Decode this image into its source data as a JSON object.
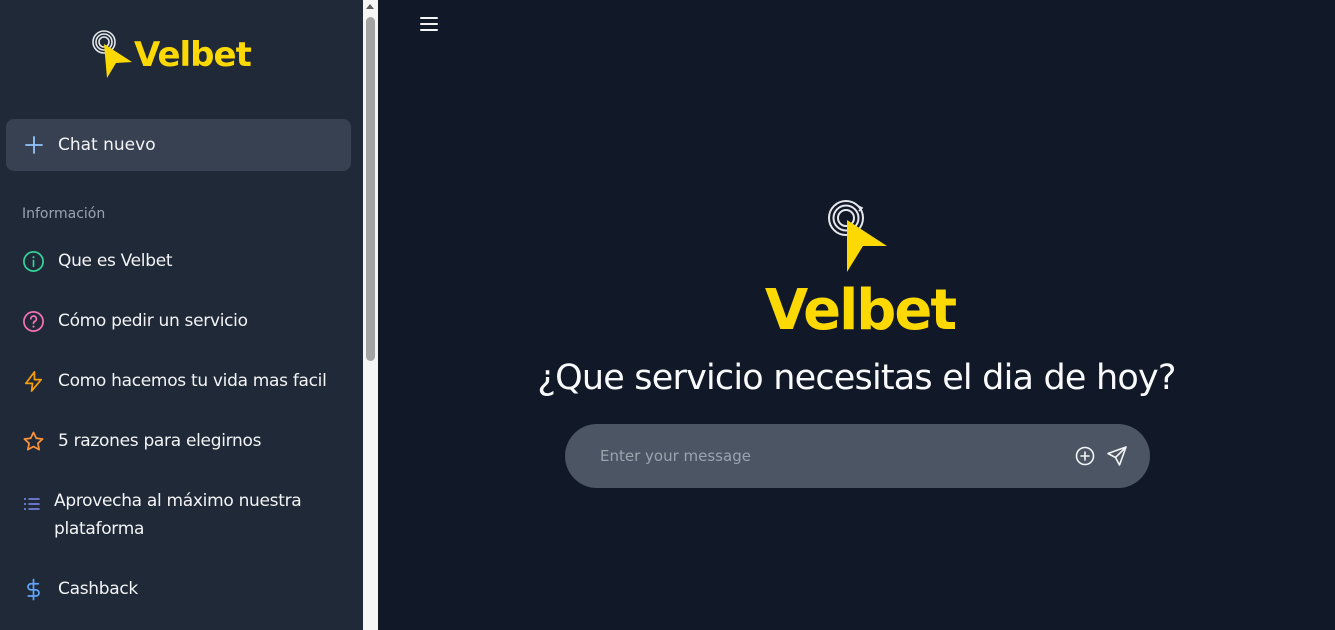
{
  "brand": {
    "name": "Velbet",
    "color": "#fcd903"
  },
  "sidebar": {
    "new_chat_label": "Chat nuevo",
    "section_title": "Información",
    "items": [
      {
        "label": "Que es Velbet",
        "icon": "info-icon",
        "color": "#34d399"
      },
      {
        "label": "Cómo pedir un servicio",
        "icon": "question-icon",
        "color": "#f472b6"
      },
      {
        "label": "Como hacemos tu vida mas facil",
        "icon": "lightning-icon",
        "color": "#f59e0b"
      },
      {
        "label": "5 razones para elegirnos",
        "icon": "star-icon",
        "color": "#fb923c"
      },
      {
        "label": "Aprovecha al máximo nuestra plataforma",
        "icon": "list-icon",
        "color": "#818cf8"
      },
      {
        "label": "Cashback",
        "icon": "dollar-icon",
        "color": "#60a5fa"
      }
    ]
  },
  "main": {
    "headline": "¿Que servicio necesitas el dia de hoy?",
    "input_placeholder": "Enter your message"
  }
}
